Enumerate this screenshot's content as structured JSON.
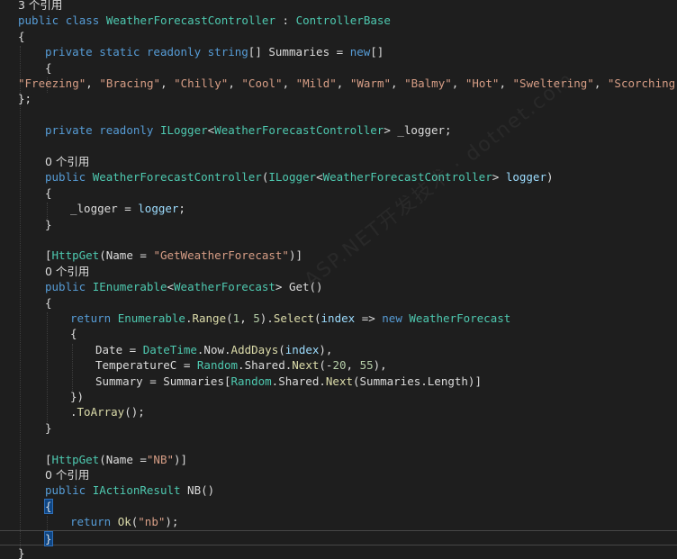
{
  "colors": {
    "background": "#1e1e1e",
    "keyword": "#569cd6",
    "type": "#4ec9b0",
    "string": "#d69d85",
    "method": "#dcdcaa",
    "number": "#b5cea8",
    "parameter": "#9cdcfe",
    "plain": "#dcdcdc",
    "codelens": "#999999",
    "brace_match": "#0e4583"
  },
  "watermark": "ASP.NET开发技术 · dotnet.com",
  "lines": [
    {
      "kind": "lens",
      "indent": 20,
      "tokens": [
        {
          "c": "tx",
          "t": "3 个引用"
        }
      ]
    },
    {
      "kind": "code",
      "indent": 20,
      "tokens": [
        {
          "c": "kw",
          "t": "public "
        },
        {
          "c": "kw",
          "t": "class "
        },
        {
          "c": "ty",
          "t": "WeatherForecastController"
        },
        {
          "c": "tx",
          "t": " : "
        },
        {
          "c": "ty",
          "t": "ControllerBase"
        }
      ]
    },
    {
      "kind": "code",
      "indent": 20,
      "tokens": [
        {
          "c": "tx",
          "t": "{"
        }
      ]
    },
    {
      "kind": "code",
      "indent": 50,
      "tokens": [
        {
          "c": "kw",
          "t": "private "
        },
        {
          "c": "kw",
          "t": "static "
        },
        {
          "c": "kw",
          "t": "readonly "
        },
        {
          "c": "kw",
          "t": "string"
        },
        {
          "c": "tx",
          "t": "[] Summaries = "
        },
        {
          "c": "kw",
          "t": "new"
        },
        {
          "c": "tx",
          "t": "[]"
        }
      ]
    },
    {
      "kind": "code",
      "indent": 50,
      "tokens": [
        {
          "c": "tx",
          "t": "{"
        }
      ]
    },
    {
      "kind": "code",
      "indent": 20,
      "tokens": [
        {
          "c": "st",
          "t": "\"Freezing\""
        },
        {
          "c": "tx",
          "t": ", "
        },
        {
          "c": "st",
          "t": "\"Bracing\""
        },
        {
          "c": "tx",
          "t": ", "
        },
        {
          "c": "st",
          "t": "\"Chilly\""
        },
        {
          "c": "tx",
          "t": ", "
        },
        {
          "c": "st",
          "t": "\"Cool\""
        },
        {
          "c": "tx",
          "t": ", "
        },
        {
          "c": "st",
          "t": "\"Mild\""
        },
        {
          "c": "tx",
          "t": ", "
        },
        {
          "c": "st",
          "t": "\"Warm\""
        },
        {
          "c": "tx",
          "t": ", "
        },
        {
          "c": "st",
          "t": "\"Balmy\""
        },
        {
          "c": "tx",
          "t": ", "
        },
        {
          "c": "st",
          "t": "\"Hot\""
        },
        {
          "c": "tx",
          "t": ", "
        },
        {
          "c": "st",
          "t": "\"Sweltering\""
        },
        {
          "c": "tx",
          "t": ", "
        },
        {
          "c": "st",
          "t": "\"Scorching\""
        }
      ]
    },
    {
      "kind": "code",
      "indent": 20,
      "tokens": [
        {
          "c": "tx",
          "t": "};"
        }
      ]
    },
    {
      "kind": "blank",
      "indent": 20,
      "tokens": []
    },
    {
      "kind": "code",
      "indent": 50,
      "tokens": [
        {
          "c": "kw",
          "t": "private "
        },
        {
          "c": "kw",
          "t": "readonly "
        },
        {
          "c": "ty",
          "t": "ILogger"
        },
        {
          "c": "tx",
          "t": "<"
        },
        {
          "c": "ty",
          "t": "WeatherForecastController"
        },
        {
          "c": "tx",
          "t": "> _logger;"
        }
      ]
    },
    {
      "kind": "blank",
      "indent": 20,
      "tokens": []
    },
    {
      "kind": "lens",
      "indent": 50,
      "tokens": [
        {
          "c": "tx",
          "t": "0 个引用"
        }
      ]
    },
    {
      "kind": "code",
      "indent": 50,
      "tokens": [
        {
          "c": "kw",
          "t": "public "
        },
        {
          "c": "ty",
          "t": "WeatherForecastController"
        },
        {
          "c": "tx",
          "t": "("
        },
        {
          "c": "ty",
          "t": "ILogger"
        },
        {
          "c": "tx",
          "t": "<"
        },
        {
          "c": "ty",
          "t": "WeatherForecastController"
        },
        {
          "c": "tx",
          "t": "> "
        },
        {
          "c": "pa",
          "t": "logger"
        },
        {
          "c": "tx",
          "t": ")"
        }
      ]
    },
    {
      "kind": "code",
      "indent": 50,
      "tokens": [
        {
          "c": "tx",
          "t": "{"
        }
      ]
    },
    {
      "kind": "code",
      "indent": 78,
      "tokens": [
        {
          "c": "tx",
          "t": "_logger = "
        },
        {
          "c": "pa",
          "t": "logger"
        },
        {
          "c": "tx",
          "t": ";"
        }
      ]
    },
    {
      "kind": "code",
      "indent": 50,
      "tokens": [
        {
          "c": "tx",
          "t": "}"
        }
      ]
    },
    {
      "kind": "blank",
      "indent": 20,
      "tokens": []
    },
    {
      "kind": "code",
      "indent": 50,
      "tokens": [
        {
          "c": "tx",
          "t": "["
        },
        {
          "c": "ty",
          "t": "HttpGet"
        },
        {
          "c": "tx",
          "t": "(Name = "
        },
        {
          "c": "st",
          "t": "\"GetWeatherForecast\""
        },
        {
          "c": "tx",
          "t": ")]"
        }
      ]
    },
    {
      "kind": "lens",
      "indent": 50,
      "tokens": [
        {
          "c": "tx",
          "t": "0 个引用"
        }
      ]
    },
    {
      "kind": "code",
      "indent": 50,
      "tokens": [
        {
          "c": "kw",
          "t": "public "
        },
        {
          "c": "ty",
          "t": "IEnumerable"
        },
        {
          "c": "tx",
          "t": "<"
        },
        {
          "c": "ty",
          "t": "WeatherForecast"
        },
        {
          "c": "tx",
          "t": "> Get()"
        }
      ]
    },
    {
      "kind": "code",
      "indent": 50,
      "tokens": [
        {
          "c": "tx",
          "t": "{"
        }
      ]
    },
    {
      "kind": "code",
      "indent": 78,
      "tokens": [
        {
          "c": "kw",
          "t": "return "
        },
        {
          "c": "ty",
          "t": "Enumerable"
        },
        {
          "c": "tx",
          "t": "."
        },
        {
          "c": "mt",
          "t": "Range"
        },
        {
          "c": "tx",
          "t": "("
        },
        {
          "c": "nu",
          "t": "1"
        },
        {
          "c": "tx",
          "t": ", "
        },
        {
          "c": "nu",
          "t": "5"
        },
        {
          "c": "tx",
          "t": ")."
        },
        {
          "c": "mt",
          "t": "Select"
        },
        {
          "c": "tx",
          "t": "("
        },
        {
          "c": "pa",
          "t": "index"
        },
        {
          "c": "tx",
          "t": " => "
        },
        {
          "c": "kw",
          "t": "new "
        },
        {
          "c": "ty",
          "t": "WeatherForecast"
        }
      ]
    },
    {
      "kind": "code",
      "indent": 78,
      "tokens": [
        {
          "c": "tx",
          "t": "{"
        }
      ]
    },
    {
      "kind": "code",
      "indent": 106,
      "tokens": [
        {
          "c": "tx",
          "t": "Date = "
        },
        {
          "c": "ty",
          "t": "DateTime"
        },
        {
          "c": "tx",
          "t": ".Now."
        },
        {
          "c": "mt",
          "t": "AddDays"
        },
        {
          "c": "tx",
          "t": "("
        },
        {
          "c": "pa",
          "t": "index"
        },
        {
          "c": "tx",
          "t": "),"
        }
      ]
    },
    {
      "kind": "code",
      "indent": 106,
      "tokens": [
        {
          "c": "tx",
          "t": "TemperatureC = "
        },
        {
          "c": "ty",
          "t": "Random"
        },
        {
          "c": "tx",
          "t": ".Shared."
        },
        {
          "c": "mt",
          "t": "Next"
        },
        {
          "c": "tx",
          "t": "(-"
        },
        {
          "c": "nu",
          "t": "20"
        },
        {
          "c": "tx",
          "t": ", "
        },
        {
          "c": "nu",
          "t": "55"
        },
        {
          "c": "tx",
          "t": "),"
        }
      ]
    },
    {
      "kind": "code",
      "indent": 106,
      "tokens": [
        {
          "c": "tx",
          "t": "Summary = Summaries["
        },
        {
          "c": "ty",
          "t": "Random"
        },
        {
          "c": "tx",
          "t": ".Shared."
        },
        {
          "c": "mt",
          "t": "Next"
        },
        {
          "c": "tx",
          "t": "(Summaries.Length)]"
        }
      ]
    },
    {
      "kind": "code",
      "indent": 78,
      "tokens": [
        {
          "c": "tx",
          "t": "})"
        }
      ]
    },
    {
      "kind": "code",
      "indent": 78,
      "tokens": [
        {
          "c": "tx",
          "t": "."
        },
        {
          "c": "mt",
          "t": "ToArray"
        },
        {
          "c": "tx",
          "t": "();"
        }
      ]
    },
    {
      "kind": "code",
      "indent": 50,
      "tokens": [
        {
          "c": "tx",
          "t": "}"
        }
      ]
    },
    {
      "kind": "blank",
      "indent": 20,
      "tokens": []
    },
    {
      "kind": "code",
      "indent": 50,
      "tokens": [
        {
          "c": "tx",
          "t": "["
        },
        {
          "c": "ty",
          "t": "HttpGet"
        },
        {
          "c": "tx",
          "t": "(Name ="
        },
        {
          "c": "st",
          "t": "\"NB\""
        },
        {
          "c": "tx",
          "t": ")]"
        }
      ]
    },
    {
      "kind": "lens",
      "indent": 50,
      "tokens": [
        {
          "c": "tx",
          "t": "0 个引用"
        }
      ]
    },
    {
      "kind": "code",
      "indent": 50,
      "tokens": [
        {
          "c": "kw",
          "t": "public "
        },
        {
          "c": "ty",
          "t": "IActionResult"
        },
        {
          "c": "tx",
          "t": " NB()"
        }
      ]
    },
    {
      "kind": "code",
      "indent": 50,
      "tokens": [
        {
          "c": "bm",
          "t": "{"
        }
      ]
    },
    {
      "kind": "code",
      "indent": 78,
      "tokens": [
        {
          "c": "kw",
          "t": "return "
        },
        {
          "c": "mt",
          "t": "Ok"
        },
        {
          "c": "tx",
          "t": "("
        },
        {
          "c": "st",
          "t": "\"nb\""
        },
        {
          "c": "tx",
          "t": ");"
        }
      ]
    },
    {
      "kind": "current",
      "indent": 50,
      "tokens": [
        {
          "c": "bm",
          "t": "}"
        }
      ]
    },
    {
      "kind": "code",
      "indent": 20,
      "tokens": [
        {
          "c": "tx",
          "t": "}"
        }
      ]
    }
  ]
}
